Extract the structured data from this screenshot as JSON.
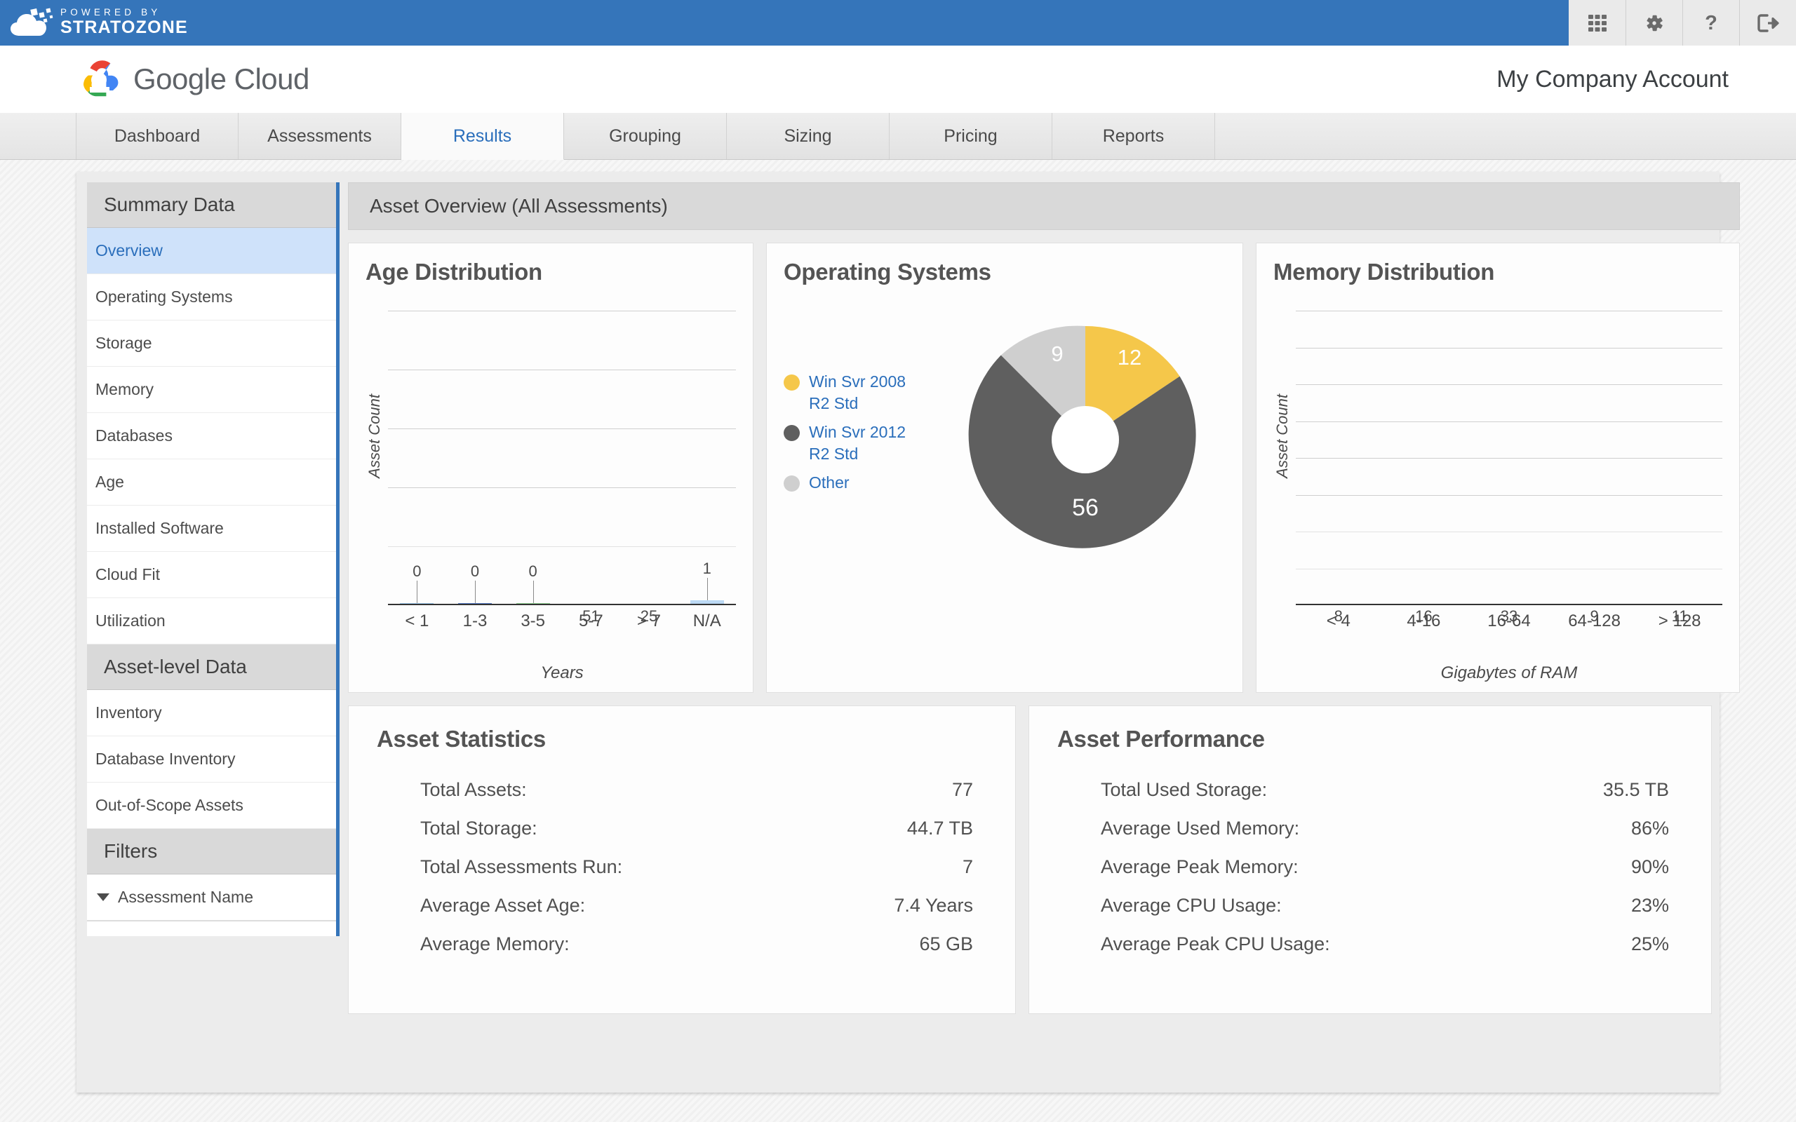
{
  "topbar": {
    "powered_by": "POWERED BY",
    "brand": "STRATOZONE",
    "icons": [
      {
        "name": "apps-grid-icon",
        "glyph": "grid"
      },
      {
        "name": "gear-icon",
        "glyph": "gear"
      },
      {
        "name": "help-icon",
        "glyph": "?"
      },
      {
        "name": "logout-icon",
        "glyph": "logout"
      }
    ],
    "accent_color": "#3575ba"
  },
  "header": {
    "product": "Google Cloud",
    "product_google": "Google",
    "product_cloud": "Cloud",
    "account": "My Company Account"
  },
  "nav": {
    "tabs": [
      {
        "label": "Dashboard",
        "active": false
      },
      {
        "label": "Assessments",
        "active": false
      },
      {
        "label": "Results",
        "active": true
      },
      {
        "label": "Grouping",
        "active": false
      },
      {
        "label": "Sizing",
        "active": false
      },
      {
        "label": "Pricing",
        "active": false
      },
      {
        "label": "Reports",
        "active": false
      }
    ],
    "active_color": "#2a6ebb"
  },
  "sidebar": {
    "summary_header": "Summary Data",
    "summary_items": [
      {
        "label": "Overview",
        "active": true
      },
      {
        "label": "Operating Systems",
        "active": false
      },
      {
        "label": "Storage",
        "active": false
      },
      {
        "label": "Memory",
        "active": false
      },
      {
        "label": "Databases",
        "active": false
      },
      {
        "label": "Age",
        "active": false
      },
      {
        "label": "Installed Software",
        "active": false
      },
      {
        "label": "Cloud Fit",
        "active": false
      },
      {
        "label": "Utilization",
        "active": false
      }
    ],
    "asset_header": "Asset-level Data",
    "asset_items": [
      {
        "label": "Inventory"
      },
      {
        "label": "Database Inventory"
      },
      {
        "label": "Out-of-Scope Assets"
      }
    ],
    "filters_header": "Filters",
    "filters": [
      {
        "label": "Assessment Name",
        "expanded": true
      }
    ]
  },
  "main": {
    "page_title": "Asset Overview (All Assessments)"
  },
  "chart_data": [
    {
      "type": "bar",
      "title": "Age Distribution",
      "xlabel": "Years",
      "ylabel": "Asset Count",
      "categories": [
        "< 1",
        "1-3",
        "3-5",
        "5-7",
        "> 7",
        "N/A"
      ],
      "values": [
        0,
        0,
        0,
        51,
        25,
        1
      ],
      "colors": [
        "#9fc9ec",
        "#5b7fcb",
        "#92d293",
        "#f7cf6b",
        "#84b7e3",
        "#bcd9f4"
      ],
      "ylim": [
        0,
        60
      ],
      "grid": true,
      "legend": "none"
    },
    {
      "type": "pie",
      "title": "Operating Systems",
      "donut": true,
      "labels": [
        "Win Svr 2008 R2 Std",
        "Win Svr 2012 R2 Std",
        "Other"
      ],
      "legend_lines": [
        [
          "Win Svr 2008",
          "R2 Std"
        ],
        [
          "Win Svr 2012",
          "R2 Std"
        ],
        [
          "Other"
        ]
      ],
      "values": [
        12,
        56,
        9
      ],
      "colors": [
        "#f5c74a",
        "#5f5f5f",
        "#cfcfcf"
      ],
      "total": 77,
      "legend": "left"
    },
    {
      "type": "bar",
      "title": "Memory Distribution",
      "xlabel": "Gigabytes of RAM",
      "ylabel": "Asset Count",
      "categories": [
        "< 4",
        "4-16",
        "16-64",
        "64-128",
        "> 128"
      ],
      "values": [
        8,
        16,
        33,
        9,
        11
      ],
      "colors": [
        "#a9d3f0",
        "#6d8ed3",
        "#96d695",
        "#f8d277",
        "#7fb3e0"
      ],
      "ylim": [
        0,
        40
      ],
      "grid": true,
      "legend": "none"
    }
  ],
  "asset_statistics": {
    "title": "Asset Statistics",
    "rows": [
      {
        "label": "Total Assets:",
        "value": "77"
      },
      {
        "label": "Total Storage:",
        "value": "44.7 TB"
      },
      {
        "label": "Total Assessments Run:",
        "value": "7"
      },
      {
        "label": "Average Asset Age:",
        "value": "7.4 Years"
      },
      {
        "label": "Average Memory:",
        "value": "65 GB"
      }
    ]
  },
  "asset_performance": {
    "title": "Asset Performance",
    "rows": [
      {
        "label": "Total Used Storage:",
        "value": "35.5 TB"
      },
      {
        "label": "Average Used Memory:",
        "value": "86%"
      },
      {
        "label": "Average Peak Memory:",
        "value": "90%"
      },
      {
        "label": "Average CPU Usage:",
        "value": "23%"
      },
      {
        "label": "Average Peak CPU Usage:",
        "value": "25%"
      }
    ]
  }
}
